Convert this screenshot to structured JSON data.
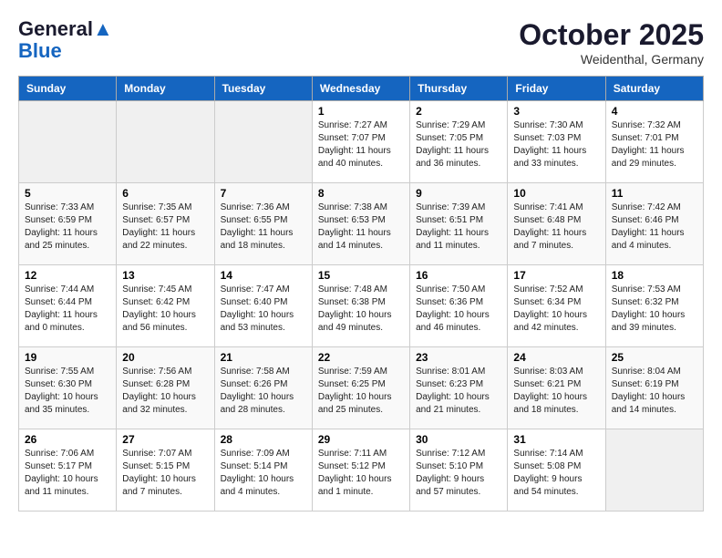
{
  "header": {
    "logo_general": "General",
    "logo_blue": "Blue",
    "month": "October 2025",
    "location": "Weidenthal, Germany"
  },
  "weekdays": [
    "Sunday",
    "Monday",
    "Tuesday",
    "Wednesday",
    "Thursday",
    "Friday",
    "Saturday"
  ],
  "weeks": [
    [
      {
        "day": "",
        "info": ""
      },
      {
        "day": "",
        "info": ""
      },
      {
        "day": "",
        "info": ""
      },
      {
        "day": "1",
        "info": "Sunrise: 7:27 AM\nSunset: 7:07 PM\nDaylight: 11 hours\nand 40 minutes."
      },
      {
        "day": "2",
        "info": "Sunrise: 7:29 AM\nSunset: 7:05 PM\nDaylight: 11 hours\nand 36 minutes."
      },
      {
        "day": "3",
        "info": "Sunrise: 7:30 AM\nSunset: 7:03 PM\nDaylight: 11 hours\nand 33 minutes."
      },
      {
        "day": "4",
        "info": "Sunrise: 7:32 AM\nSunset: 7:01 PM\nDaylight: 11 hours\nand 29 minutes."
      }
    ],
    [
      {
        "day": "5",
        "info": "Sunrise: 7:33 AM\nSunset: 6:59 PM\nDaylight: 11 hours\nand 25 minutes."
      },
      {
        "day": "6",
        "info": "Sunrise: 7:35 AM\nSunset: 6:57 PM\nDaylight: 11 hours\nand 22 minutes."
      },
      {
        "day": "7",
        "info": "Sunrise: 7:36 AM\nSunset: 6:55 PM\nDaylight: 11 hours\nand 18 minutes."
      },
      {
        "day": "8",
        "info": "Sunrise: 7:38 AM\nSunset: 6:53 PM\nDaylight: 11 hours\nand 14 minutes."
      },
      {
        "day": "9",
        "info": "Sunrise: 7:39 AM\nSunset: 6:51 PM\nDaylight: 11 hours\nand 11 minutes."
      },
      {
        "day": "10",
        "info": "Sunrise: 7:41 AM\nSunset: 6:48 PM\nDaylight: 11 hours\nand 7 minutes."
      },
      {
        "day": "11",
        "info": "Sunrise: 7:42 AM\nSunset: 6:46 PM\nDaylight: 11 hours\nand 4 minutes."
      }
    ],
    [
      {
        "day": "12",
        "info": "Sunrise: 7:44 AM\nSunset: 6:44 PM\nDaylight: 11 hours\nand 0 minutes."
      },
      {
        "day": "13",
        "info": "Sunrise: 7:45 AM\nSunset: 6:42 PM\nDaylight: 10 hours\nand 56 minutes."
      },
      {
        "day": "14",
        "info": "Sunrise: 7:47 AM\nSunset: 6:40 PM\nDaylight: 10 hours\nand 53 minutes."
      },
      {
        "day": "15",
        "info": "Sunrise: 7:48 AM\nSunset: 6:38 PM\nDaylight: 10 hours\nand 49 minutes."
      },
      {
        "day": "16",
        "info": "Sunrise: 7:50 AM\nSunset: 6:36 PM\nDaylight: 10 hours\nand 46 minutes."
      },
      {
        "day": "17",
        "info": "Sunrise: 7:52 AM\nSunset: 6:34 PM\nDaylight: 10 hours\nand 42 minutes."
      },
      {
        "day": "18",
        "info": "Sunrise: 7:53 AM\nSunset: 6:32 PM\nDaylight: 10 hours\nand 39 minutes."
      }
    ],
    [
      {
        "day": "19",
        "info": "Sunrise: 7:55 AM\nSunset: 6:30 PM\nDaylight: 10 hours\nand 35 minutes."
      },
      {
        "day": "20",
        "info": "Sunrise: 7:56 AM\nSunset: 6:28 PM\nDaylight: 10 hours\nand 32 minutes."
      },
      {
        "day": "21",
        "info": "Sunrise: 7:58 AM\nSunset: 6:26 PM\nDaylight: 10 hours\nand 28 minutes."
      },
      {
        "day": "22",
        "info": "Sunrise: 7:59 AM\nSunset: 6:25 PM\nDaylight: 10 hours\nand 25 minutes."
      },
      {
        "day": "23",
        "info": "Sunrise: 8:01 AM\nSunset: 6:23 PM\nDaylight: 10 hours\nand 21 minutes."
      },
      {
        "day": "24",
        "info": "Sunrise: 8:03 AM\nSunset: 6:21 PM\nDaylight: 10 hours\nand 18 minutes."
      },
      {
        "day": "25",
        "info": "Sunrise: 8:04 AM\nSunset: 6:19 PM\nDaylight: 10 hours\nand 14 minutes."
      }
    ],
    [
      {
        "day": "26",
        "info": "Sunrise: 7:06 AM\nSunset: 5:17 PM\nDaylight: 10 hours\nand 11 minutes."
      },
      {
        "day": "27",
        "info": "Sunrise: 7:07 AM\nSunset: 5:15 PM\nDaylight: 10 hours\nand 7 minutes."
      },
      {
        "day": "28",
        "info": "Sunrise: 7:09 AM\nSunset: 5:14 PM\nDaylight: 10 hours\nand 4 minutes."
      },
      {
        "day": "29",
        "info": "Sunrise: 7:11 AM\nSunset: 5:12 PM\nDaylight: 10 hours\nand 1 minute."
      },
      {
        "day": "30",
        "info": "Sunrise: 7:12 AM\nSunset: 5:10 PM\nDaylight: 9 hours\nand 57 minutes."
      },
      {
        "day": "31",
        "info": "Sunrise: 7:14 AM\nSunset: 5:08 PM\nDaylight: 9 hours\nand 54 minutes."
      },
      {
        "day": "",
        "info": ""
      }
    ]
  ]
}
